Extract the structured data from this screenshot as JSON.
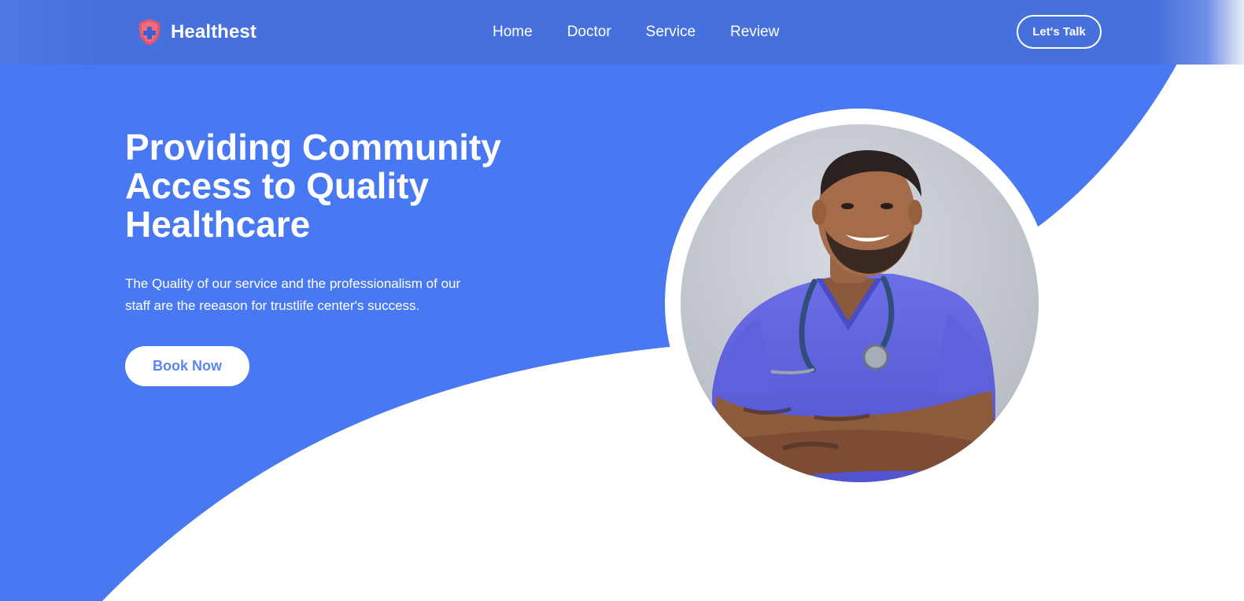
{
  "navbar": {
    "brand": {
      "name": "Healthest",
      "icon": "shield-cross-icon"
    },
    "links": [
      "Home",
      "Doctor",
      "Service",
      "Review"
    ],
    "cta_label": "Let's Talk"
  },
  "hero": {
    "title_lines": [
      "Providing Community",
      "Access to Quality",
      "Healthcare"
    ],
    "subtitle_lines": [
      "The Quality of our service and the professionalism of our",
      "staff are the reeason for trustlife center's success."
    ],
    "book_label": "Book Now",
    "portrait_label": "Doctor in blue scrubs with stethoscope"
  },
  "colors": {
    "primary_blue": "#4879f2",
    "navbar_blue": "#4671dd",
    "accent_red": "#e8556a",
    "button_text": "#5a86ec",
    "white": "#ffffff"
  }
}
